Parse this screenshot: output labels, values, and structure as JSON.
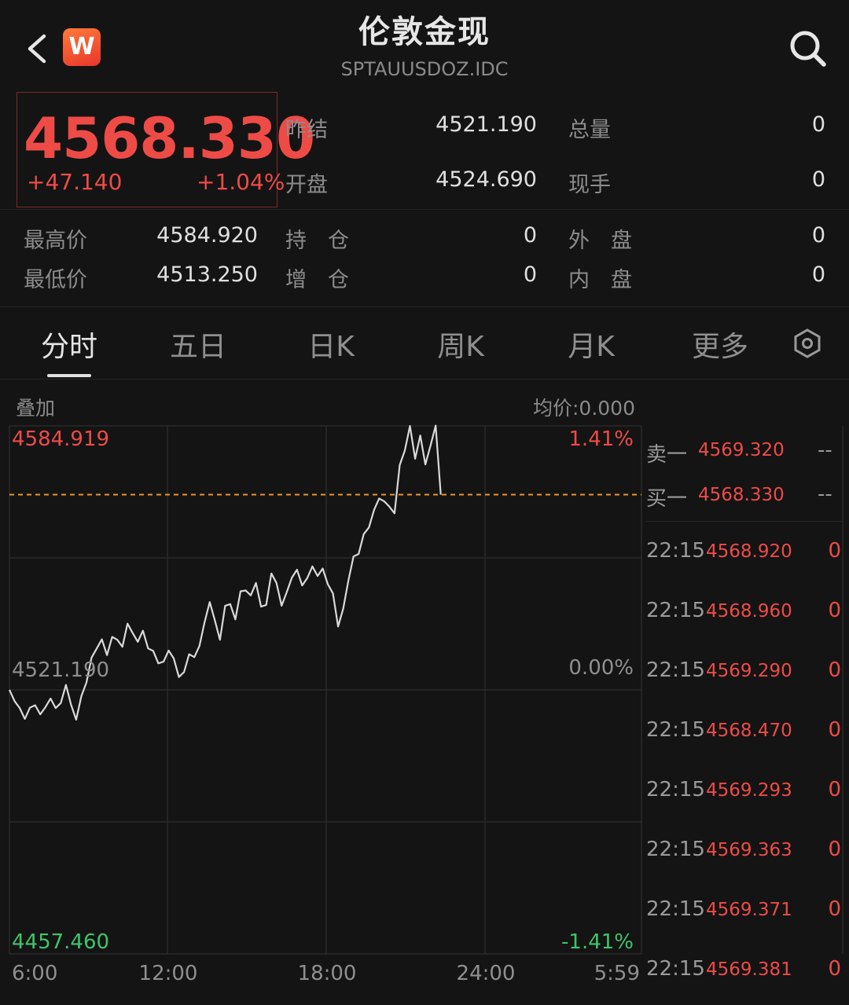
{
  "header": {
    "title": "伦敦金现",
    "code": "SPTAUUSDOZ.IDC",
    "logo_letter": "W"
  },
  "quote": {
    "price": "4568.330",
    "change": "+47.140",
    "change_pct": "+1.04%",
    "prev_settle_label": "昨结",
    "prev_settle": "4521.190",
    "open_label": "开盘",
    "open": "4524.690",
    "total_vol_label": "总量",
    "total_vol": "0",
    "cur_vol_label": "现手",
    "cur_vol": "0",
    "high_label": "最高价",
    "high": "4584.920",
    "low_label": "最低价",
    "low": "4513.250",
    "oi_label": "持　仓",
    "oi": "0",
    "oi_add_label": "增　仓",
    "oi_add": "0",
    "outer_label": "外　盘",
    "outer": "0",
    "inner_label": "内　盘",
    "inner": "0"
  },
  "tabs": [
    "分时",
    "五日",
    "日K",
    "周K",
    "月K",
    "更多"
  ],
  "active_tab": 0,
  "chart_header": {
    "overlay": "叠加",
    "avg_price": "均价:0.000"
  },
  "chart_data": {
    "type": "line",
    "y_top": "4584.919",
    "y_mid": "4521.190",
    "y_bottom": "4457.460",
    "pct_top": "1.41%",
    "pct_mid": "0.00%",
    "pct_bottom": "-1.41%",
    "x_ticks": [
      "6:00",
      "12:00",
      "18:00",
      "24:00",
      "5:59"
    ],
    "ylim": [
      4457.46,
      4584.919
    ],
    "prev_close": 4521.19,
    "current": 4568.33,
    "series": [
      {
        "values": [
          4521.2,
          4518.5,
          4516.8,
          4514.2,
          4516.9,
          4517.5,
          4515.3,
          4517.0,
          4519.1,
          4516.8,
          4518.0,
          4522.4,
          4517.6,
          4514.0,
          4519.7,
          4523.0,
          4529.0,
          4531.2,
          4533.4,
          4529.6,
          4534.0,
          4533.3,
          4531.6,
          4537.2,
          4534.9,
          4532.8,
          4535.5,
          4531.2,
          4530.6,
          4527.6,
          4528.0,
          4530.7,
          4528.8,
          4524.3,
          4525.5,
          4529.8,
          4529.1,
          4531.8,
          4537.5,
          4542.4,
          4538.0,
          4533.3,
          4541.5,
          4541.9,
          4538.2,
          4545.0,
          4545.2,
          4544.0,
          4547.0,
          4541.3,
          4541.7,
          4549.3,
          4547.0,
          4541.5,
          4544.8,
          4548.3,
          4550.2,
          4546.4,
          4548.2,
          4551.0,
          4548.7,
          4550.5,
          4546.7,
          4544.5,
          4536.5,
          4540.8,
          4547.5,
          4553.4,
          4554.0,
          4558.8,
          4560.4,
          4564.6,
          4567.4,
          4566.7,
          4565.4,
          4563.8,
          4575.5,
          4579.0,
          4584.9,
          4577.0,
          4582.6,
          4575.6,
          4580.2,
          4585.0,
          4568.3
        ]
      }
    ]
  },
  "order_book": {
    "ask_label": "卖一",
    "ask_price": "4569.320",
    "ask_vol": "--",
    "bid_label": "买一",
    "bid_price": "4568.330",
    "bid_vol": "--",
    "ticks": [
      {
        "time": "22:15",
        "price": "4568.920",
        "vol": "0"
      },
      {
        "time": "22:15",
        "price": "4568.960",
        "vol": "0"
      },
      {
        "time": "22:15",
        "price": "4569.290",
        "vol": "0"
      },
      {
        "time": "22:15",
        "price": "4568.470",
        "vol": "0"
      },
      {
        "time": "22:15",
        "price": "4569.293",
        "vol": "0"
      },
      {
        "time": "22:15",
        "price": "4569.363",
        "vol": "0"
      },
      {
        "time": "22:15",
        "price": "4569.371",
        "vol": "0"
      },
      {
        "time": "22:15",
        "price": "4569.381",
        "vol": "0"
      }
    ]
  }
}
